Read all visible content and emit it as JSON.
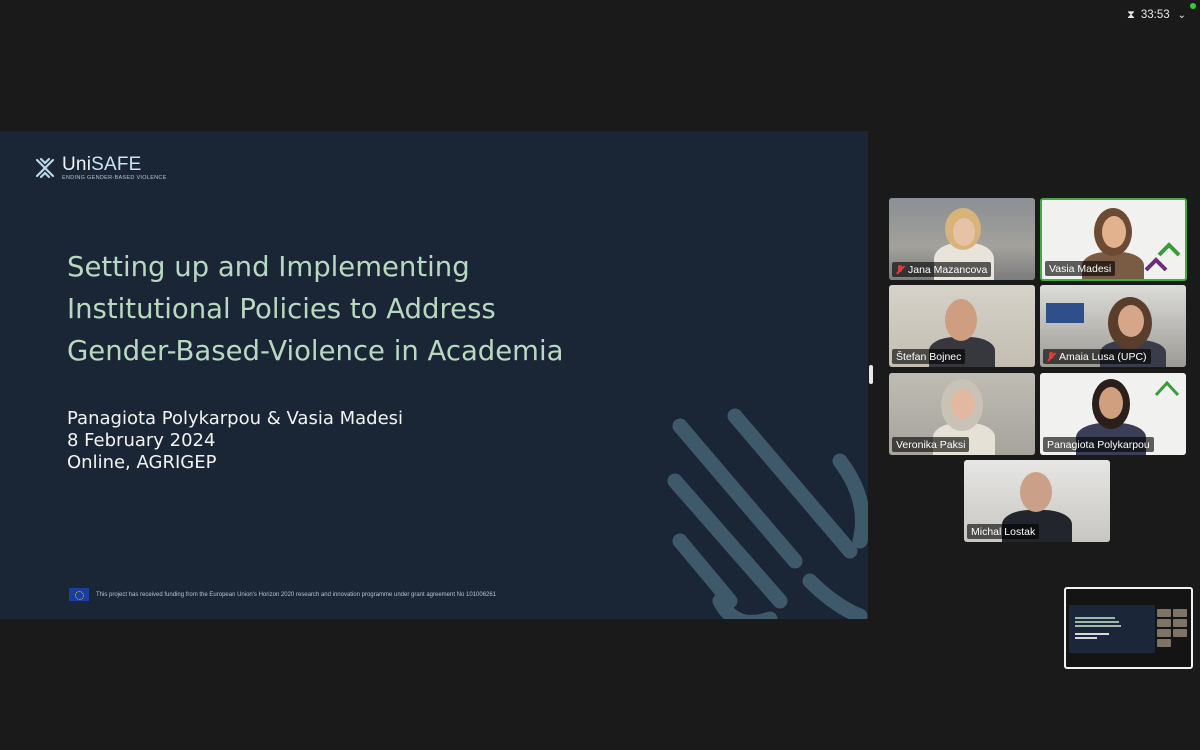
{
  "meeting": {
    "timer": "33:53"
  },
  "slide": {
    "logo_prefix": "Uni",
    "logo_suffix": "SAFE",
    "logo_tagline": "ENDING GENDER-BASED VIOLENCE",
    "title_lines": [
      "Setting up and Implementing",
      "Institutional Policies to Address",
      "Gender-Based-Violence in Academia"
    ],
    "presenters": "Panagiota Polykarpou & Vasia Madesi",
    "date": "8 February 2024",
    "venue": "Online, AGRIGEP",
    "funding_text": "This project has received funding from the European Union's Horizon 2020 research and innovation programme under grant agreement No 101006261"
  },
  "participants": [
    {
      "name": "Jana Mazancova",
      "muted": true
    },
    {
      "name": "Vasia Madesi",
      "muted": false,
      "speaking": true
    },
    {
      "name": "Štefan Bojnec",
      "muted": false
    },
    {
      "name": "Amaia Lusa (UPC)",
      "muted": true
    },
    {
      "name": "Veronika Paksi",
      "muted": false
    },
    {
      "name": "Panagiota Polykarpou",
      "muted": false
    },
    {
      "name": "Michal Lostak",
      "muted": false
    }
  ],
  "icons": {
    "timer": "hourglass-icon",
    "dropdown": "chevron-down-icon",
    "muted": "mic-off-icon"
  },
  "colors": {
    "slide_background": "#1a2535",
    "slide_title": "#b9d8c0",
    "active_speaker_border": "#3fae3f",
    "muted_icon": "#e53935"
  }
}
